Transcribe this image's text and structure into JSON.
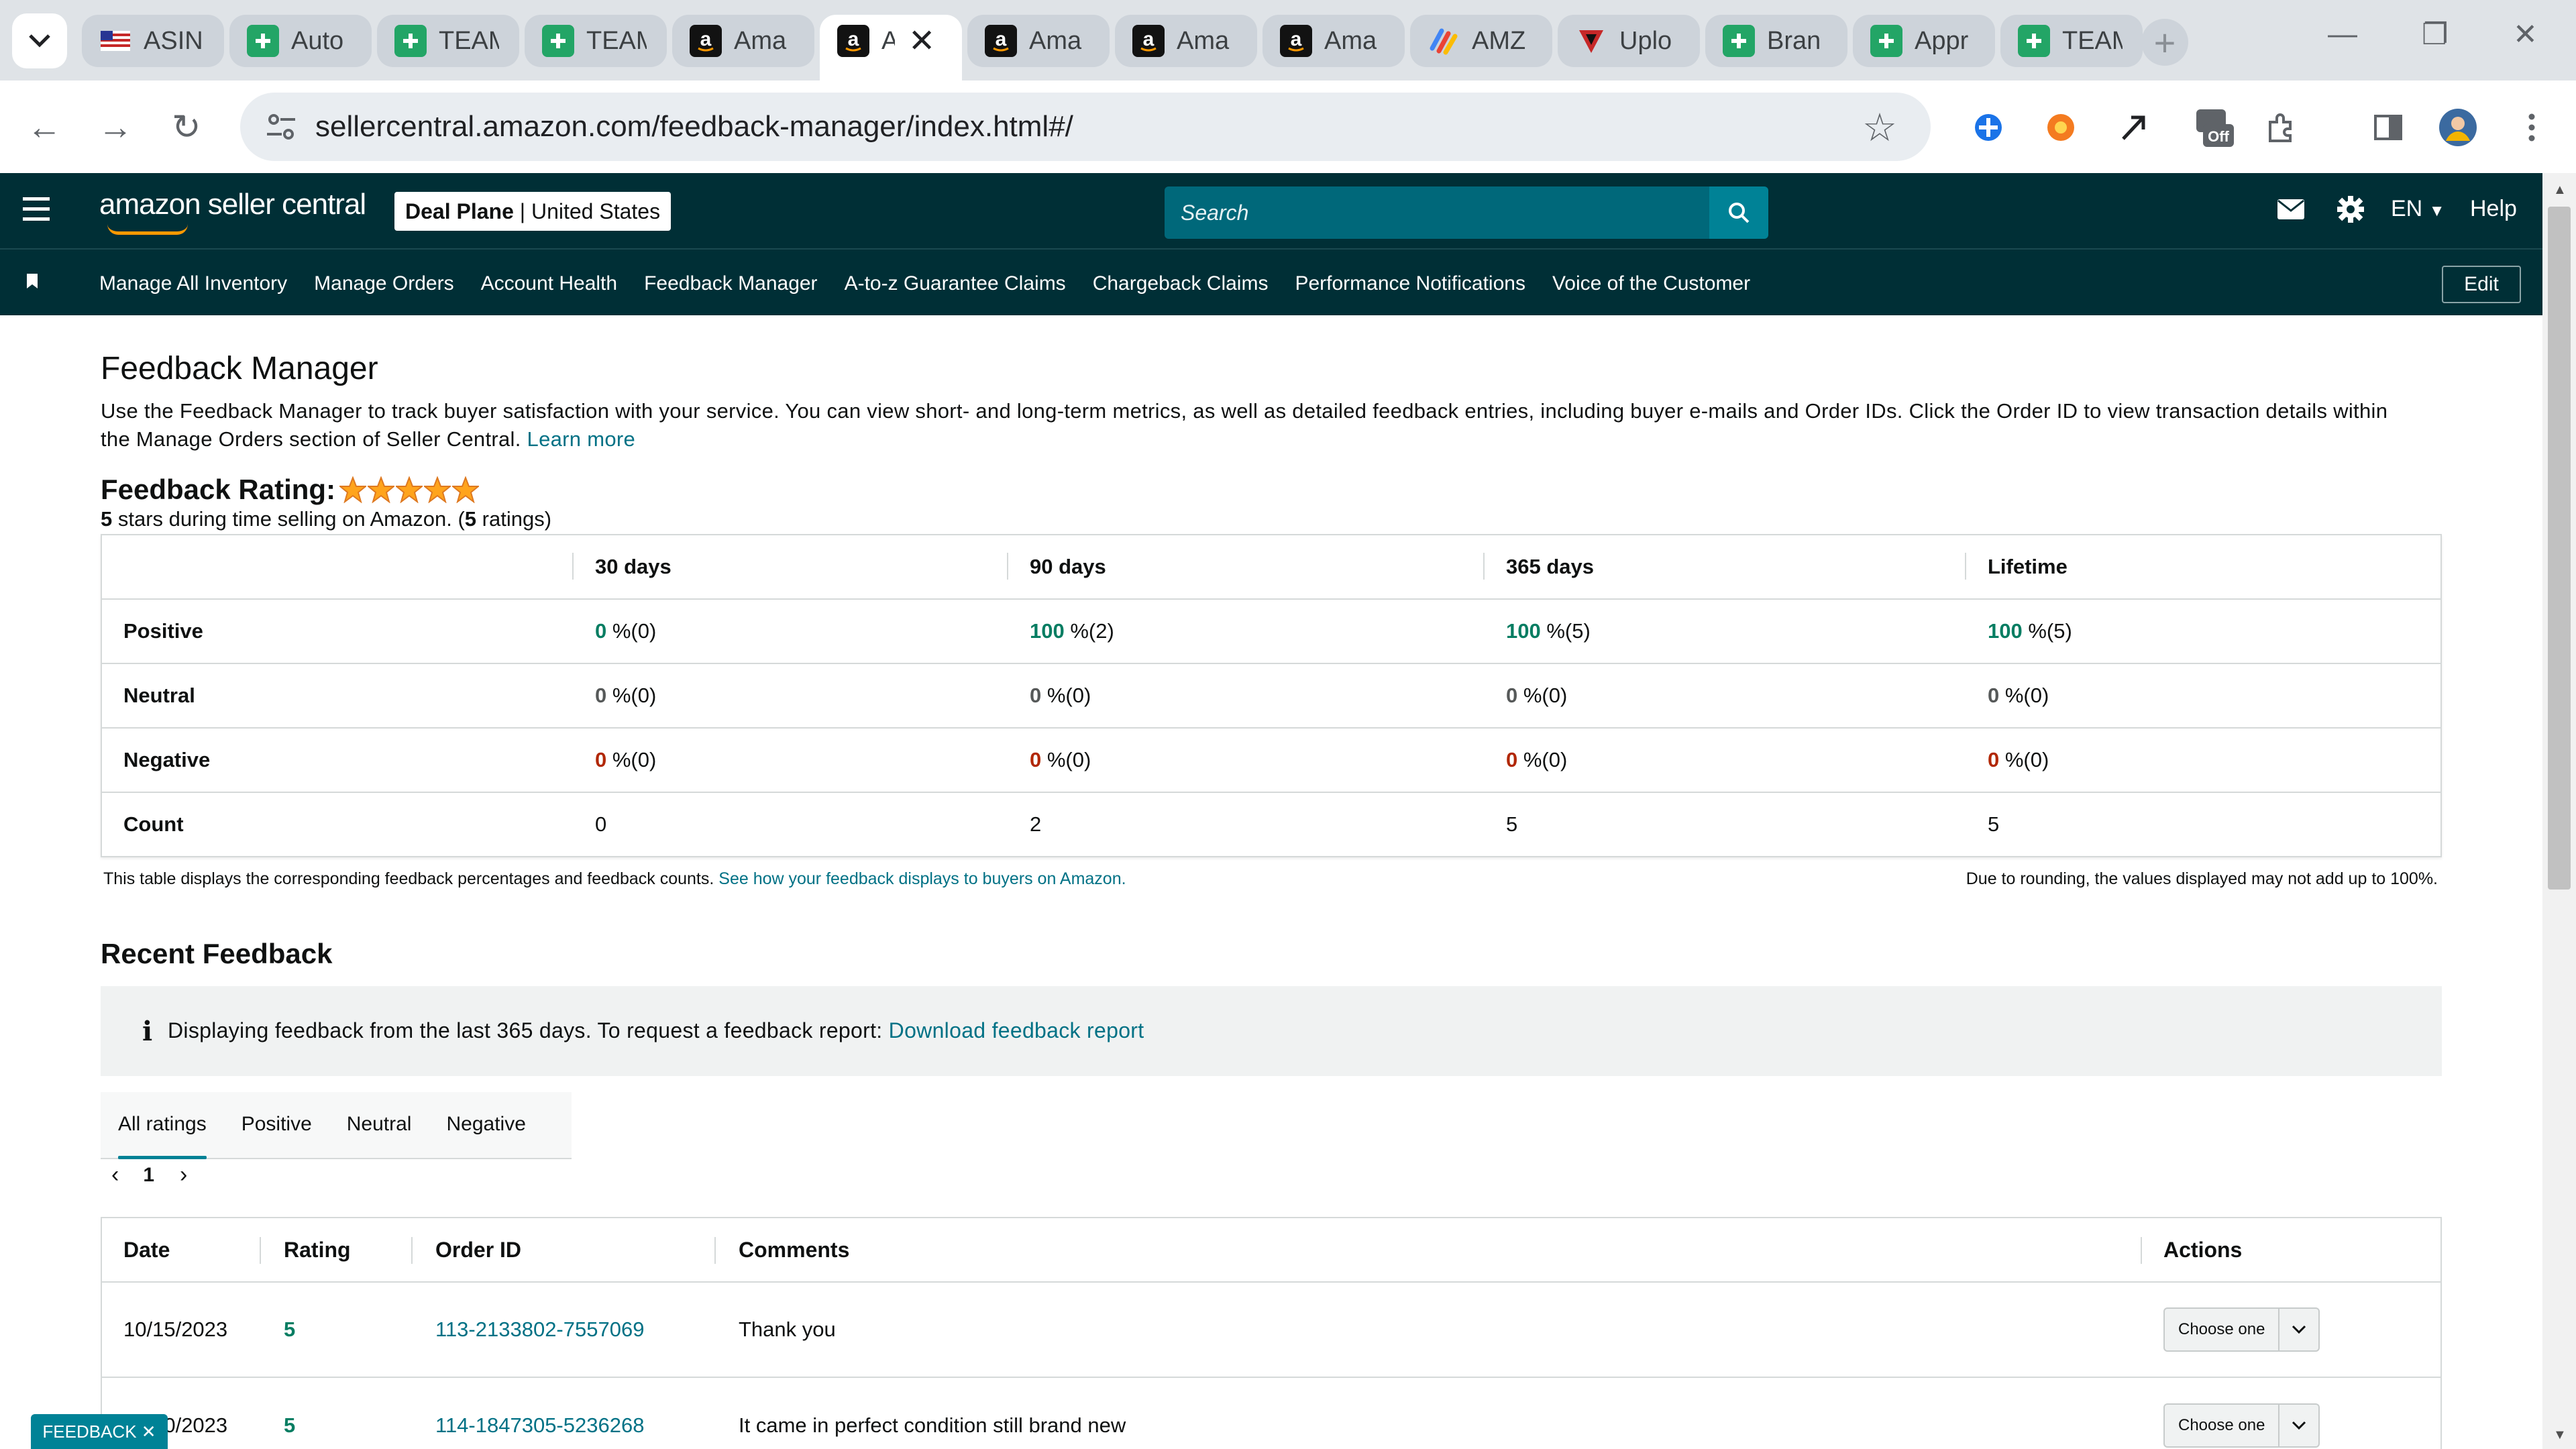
{
  "browser": {
    "tabs": [
      {
        "label": "ASIN",
        "icon": "asin-favicon"
      },
      {
        "label": "Auto",
        "icon": "sheets-plus-icon"
      },
      {
        "label": "TEAM",
        "icon": "sheets-plus-icon"
      },
      {
        "label": "TEAM",
        "icon": "sheets-plus-icon"
      },
      {
        "label": "Ama",
        "icon": "amazon-icon"
      },
      {
        "label": "A",
        "icon": "amazon-icon",
        "active": true
      },
      {
        "label": "Ama",
        "icon": "amazon-icon"
      },
      {
        "label": "Ama",
        "icon": "amazon-icon"
      },
      {
        "label": "Ama",
        "icon": "amazon-icon"
      },
      {
        "label": "AMZ",
        "icon": "amz-multicolor-icon"
      },
      {
        "label": "Uplo",
        "icon": "upload-icon"
      },
      {
        "label": "Bran",
        "icon": "sheets-plus-icon"
      },
      {
        "label": "Appr",
        "icon": "sheets-plus-icon"
      },
      {
        "label": "TEAM",
        "icon": "sheets-plus-icon"
      }
    ],
    "url": "sellercentral.amazon.com/feedback-manager/index.html#/",
    "extension_badge": "Off"
  },
  "header": {
    "logo_text": "amazon seller central",
    "account_name": "Deal Plane",
    "account_region": "United States",
    "search_placeholder": "Search",
    "language": "EN",
    "help": "Help"
  },
  "nav": {
    "links": [
      "Manage All Inventory",
      "Manage Orders",
      "Account Health",
      "Feedback Manager",
      "A-to-z Guarantee Claims",
      "Chargeback Claims",
      "Performance Notifications",
      "Voice of the Customer"
    ],
    "edit": "Edit"
  },
  "page": {
    "title": "Feedback Manager",
    "description": "Use the Feedback Manager to track buyer satisfaction with your service. You can view short- and long-term metrics, as well as detailed feedback entries, including buyer e-mails and Order IDs. Click the Order ID to view transaction details within the Manage Orders section of Seller Central.",
    "learn_more": "Learn more",
    "rating_label": "Feedback Rating:",
    "rating_stars": 5,
    "rating_value": "5",
    "rating_text_mid": " stars during time selling on Amazon. (",
    "rating_count": "5",
    "rating_text_end": " ratings)"
  },
  "metrics": {
    "columns": [
      "30 days",
      "90 days",
      "365 days",
      "Lifetime"
    ],
    "rows": [
      {
        "label": "Positive",
        "cells": [
          [
            "0",
            " %(0)"
          ],
          [
            "100",
            " %(2)"
          ],
          [
            "100",
            " %(5)"
          ],
          [
            "100",
            " %(5)"
          ]
        ]
      },
      {
        "label": "Neutral",
        "cells": [
          [
            "0",
            " %(0)"
          ],
          [
            "0",
            " %(0)"
          ],
          [
            "0",
            " %(0)"
          ],
          [
            "0",
            " %(0)"
          ]
        ]
      },
      {
        "label": "Negative",
        "cells": [
          [
            "0",
            " %(0)"
          ],
          [
            "0",
            " %(0)"
          ],
          [
            "0",
            " %(0)"
          ],
          [
            "0",
            " %(0)"
          ]
        ]
      },
      {
        "label": "Count",
        "cells": [
          [
            "0",
            ""
          ],
          [
            "2",
            ""
          ],
          [
            "5",
            ""
          ],
          [
            "5",
            ""
          ]
        ]
      }
    ],
    "footnote": "This table displays the corresponding feedback percentages and feedback counts.",
    "footnote_link": "See how your feedback displays to buyers on Amazon.",
    "rounding_note": "Due to rounding, the values displayed may not add up to 100%."
  },
  "recent": {
    "title": "Recent Feedback",
    "info_text": "Displaying feedback from the last 365 days. To request a feedback report:",
    "info_link": "Download feedback report",
    "filter_tabs": [
      "All ratings",
      "Positive",
      "Neutral",
      "Negative"
    ],
    "page": "1",
    "columns": [
      "Date",
      "Rating",
      "Order ID",
      "Comments",
      "Actions"
    ],
    "rows": [
      {
        "date": "10/15/2023",
        "rating": "5",
        "order_id": "113-2133802-7557069",
        "comment": "Thank you",
        "action": "Choose one"
      },
      {
        "date": "09/30/2023",
        "rating": "5",
        "order_id": "114-1847305-5236268",
        "comment": "It came in perfect condition still brand new",
        "action": "Choose one"
      }
    ]
  },
  "feedback_button": "FEEDBACK",
  "colors": {
    "header_bg": "#002f36",
    "link": "#007185",
    "positive": "#067d62",
    "negative": "#b12704",
    "accent": "#008296"
  }
}
